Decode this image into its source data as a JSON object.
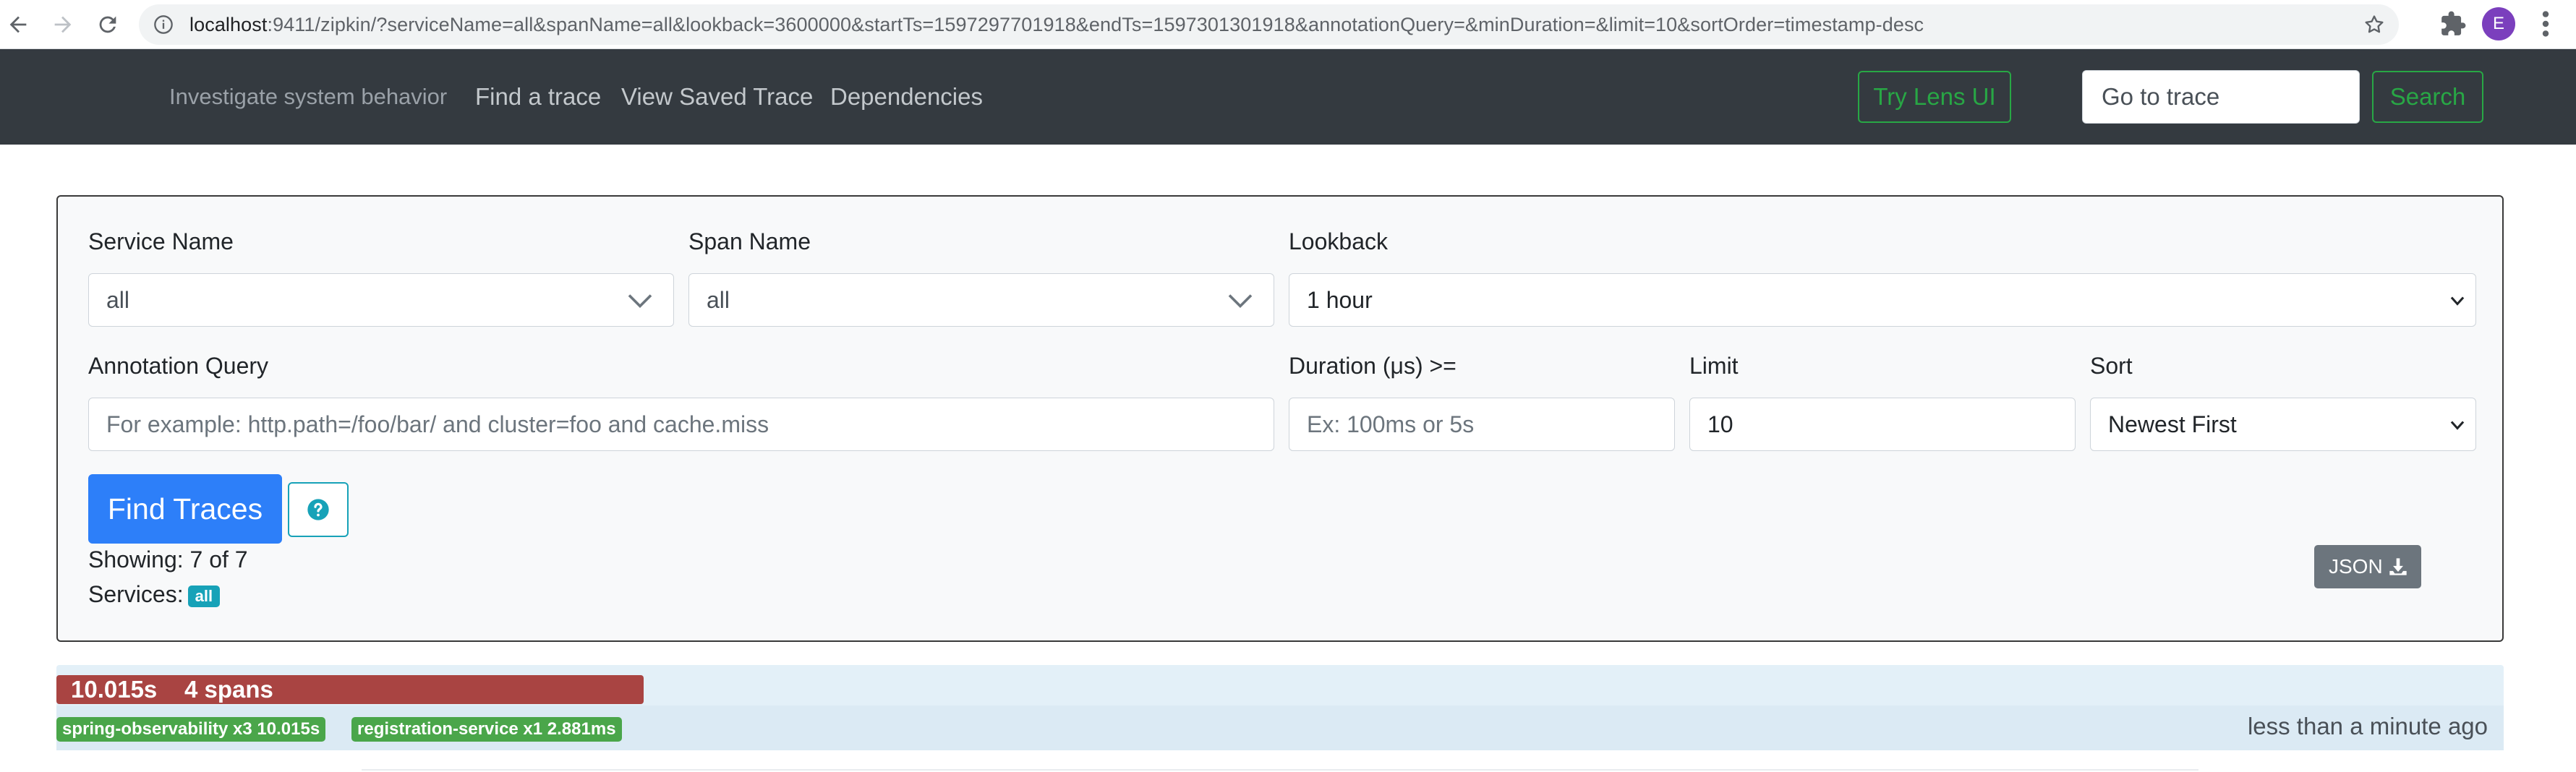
{
  "browser": {
    "url_host": "localhost",
    "url_rest": ":9411/zipkin/?serviceName=all&spanName=all&lookback=3600000&startTs=1597297701918&endTs=1597301301918&annotationQuery=&minDuration=&limit=10&sortOrder=timestamp-desc",
    "profile_initial": "E"
  },
  "navbar": {
    "brand": "Investigate system behavior",
    "links": [
      "Find a trace",
      "View Saved Trace",
      "Dependencies"
    ],
    "lens_button": "Try Lens UI",
    "goto_value": "Go to trace",
    "search_button": "Search"
  },
  "search": {
    "service_name_label": "Service Name",
    "service_name_value": "all",
    "span_name_label": "Span Name",
    "span_name_value": "all",
    "lookback_label": "Lookback",
    "lookback_value": "1 hour",
    "annotation_label": "Annotation Query",
    "annotation_placeholder": "For example: http.path=/foo/bar/ and cluster=foo and cache.miss",
    "duration_label": "Duration (μs) >=",
    "duration_placeholder": "Ex: 100ms or 5s",
    "limit_label": "Limit",
    "limit_value": "10",
    "sort_label": "Sort",
    "sort_value": "Newest First",
    "find_button": "Find Traces",
    "json_button": "JSON",
    "showing": "Showing: 7 of 7",
    "services_label": "Services:",
    "services_badge": "all"
  },
  "traces": [
    {
      "duration": "10.015s",
      "spans": "4 spans",
      "badges": [
        "spring-observability x3 10.015s",
        "registration-service x1 2.881ms"
      ],
      "time": "less than a minute ago",
      "bar_fraction": 1.0
    }
  ],
  "colors": {
    "navbar": "#343a40",
    "primary": "#2d7ff9",
    "success": "#28a745",
    "info": "#17a2b8",
    "trace_bar": "#a94442",
    "service_badge": "#4aa64a"
  }
}
